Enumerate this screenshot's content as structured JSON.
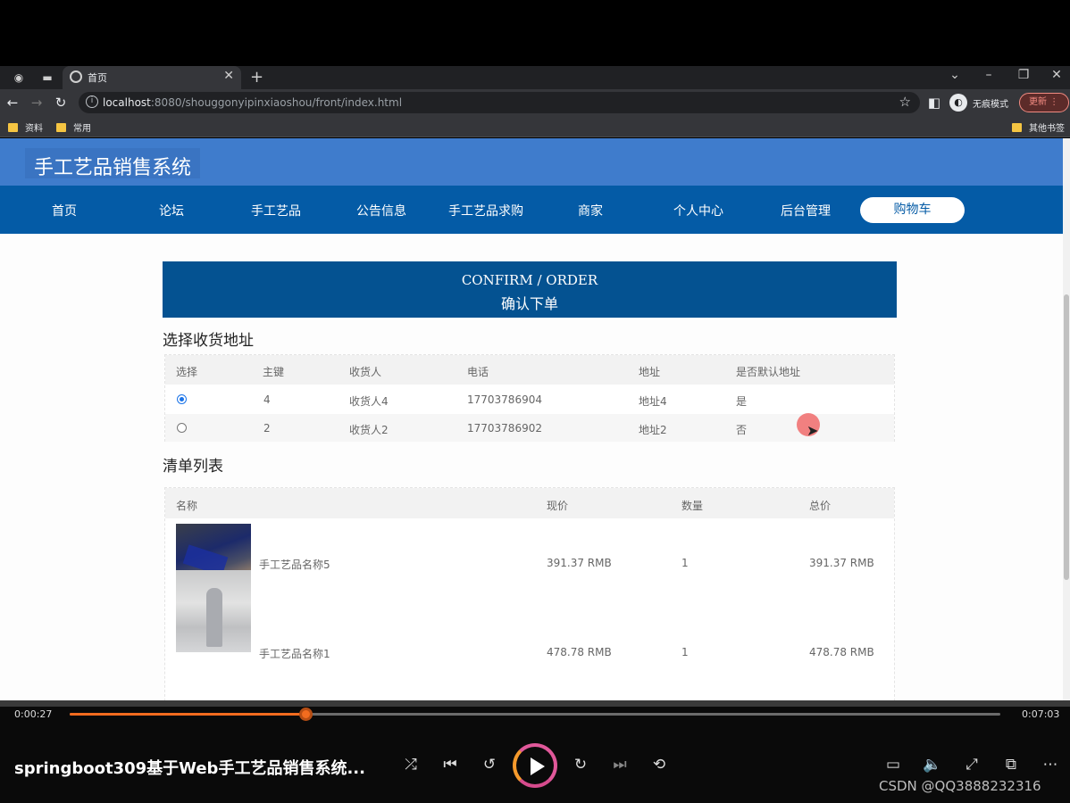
{
  "browser": {
    "tab_title": "首页",
    "url_host": "localhost",
    "url_rest": ":8080/shouggonyipinxiaoshou/front/index.html",
    "incognito_label": "无痕模式",
    "update_label": "更新",
    "bookmarks": [
      "资料",
      "常用"
    ],
    "other_bookmarks": "其他书签"
  },
  "site": {
    "title": "手工艺品销售系统",
    "nav": [
      "首页",
      "论坛",
      "手工艺品",
      "公告信息",
      "手工艺品求购",
      "商家",
      "个人中心",
      "后台管理"
    ],
    "cart": "购物车"
  },
  "confirm": {
    "title_en": "CONFIRM / ORDER",
    "title_zh": "确认下单"
  },
  "address": {
    "section_title": "选择收货地址",
    "headers": [
      "选择",
      "主键",
      "收货人",
      "电话",
      "地址",
      "是否默认地址"
    ],
    "rows": [
      {
        "selected": true,
        "id": "4",
        "name": "收货人4",
        "phone": "17703786904",
        "addr": "地址4",
        "default": "是"
      },
      {
        "selected": false,
        "id": "2",
        "name": "收货人2",
        "phone": "17703786902",
        "addr": "地址2",
        "default": "否"
      }
    ]
  },
  "items": {
    "section_title": "清单列表",
    "headers": [
      "名称",
      "现价",
      "数量",
      "总价"
    ],
    "rows": [
      {
        "name": "手工艺品名称5",
        "price": "391.37 RMB",
        "qty": "1",
        "total": "391.37 RMB"
      },
      {
        "name": "手工艺品名称1",
        "price": "478.78 RMB",
        "qty": "1",
        "total": "478.78 RMB"
      }
    ]
  },
  "player": {
    "current_time": "0:00:27",
    "total_time": "0:07:03",
    "progress_fraction": 0.254,
    "video_title": "springboot309基于Web手工艺品销售系统...",
    "watermark": "CSDN @QQ3888232316"
  }
}
